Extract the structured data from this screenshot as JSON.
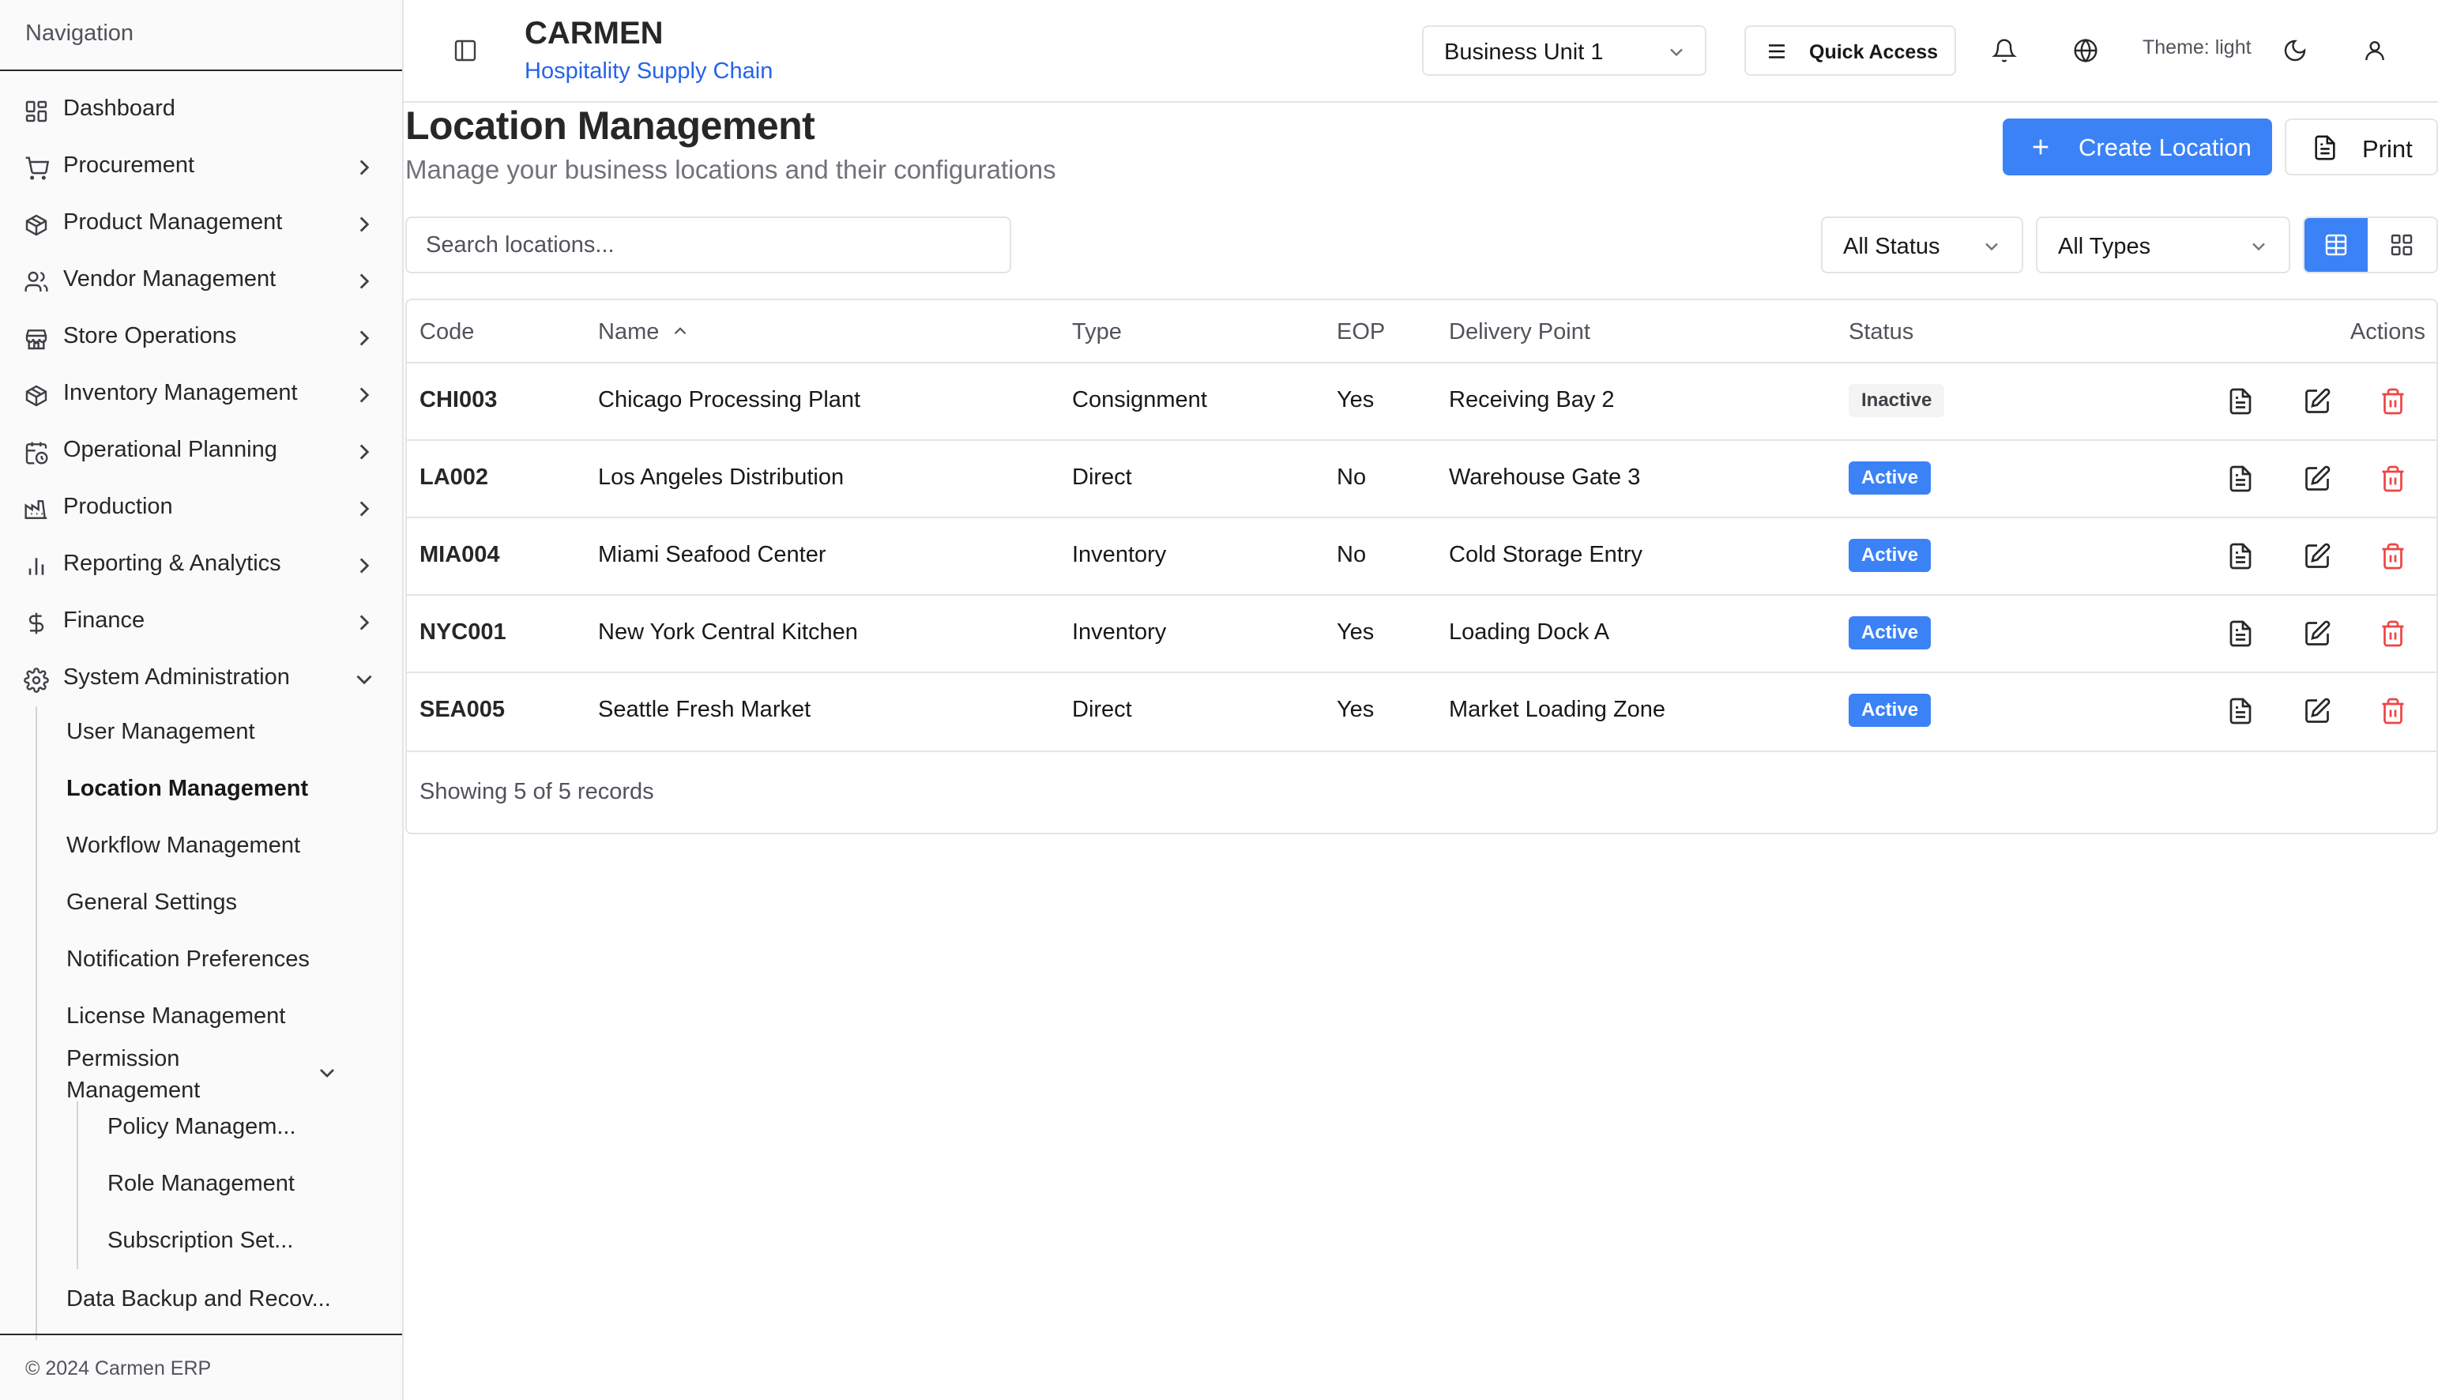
{
  "sidebar": {
    "heading": "Navigation",
    "items": [
      {
        "label": "Dashboard",
        "icon": "dashboard-icon",
        "has_chevron": false
      },
      {
        "label": "Procurement",
        "icon": "cart-icon",
        "has_chevron": true
      },
      {
        "label": "Product Management",
        "icon": "package-icon",
        "has_chevron": true
      },
      {
        "label": "Vendor Management",
        "icon": "users-icon",
        "has_chevron": true
      },
      {
        "label": "Store Operations",
        "icon": "store-icon",
        "has_chevron": true
      },
      {
        "label": "Inventory Management",
        "icon": "package-icon",
        "has_chevron": true
      },
      {
        "label": "Operational Planning",
        "icon": "calendar-clock-icon",
        "has_chevron": true
      },
      {
        "label": "Production",
        "icon": "factory-icon",
        "has_chevron": true
      },
      {
        "label": "Reporting & Analytics",
        "icon": "bar-chart-icon",
        "has_chevron": true
      },
      {
        "label": "Finance",
        "icon": "dollar-icon",
        "has_chevron": true
      },
      {
        "label": "System Administration",
        "icon": "gear-icon",
        "expanded": true
      }
    ],
    "sub_items": [
      {
        "label": "User Management"
      },
      {
        "label": "Location Management",
        "active": true
      },
      {
        "label": "Workflow Management"
      },
      {
        "label": "General Settings"
      },
      {
        "label": "Notification Preferences"
      },
      {
        "label": "License Management"
      },
      {
        "label": "Permission Management",
        "expanded": true
      },
      {
        "label": "Data Backup and Recov..."
      }
    ],
    "permission_items": [
      {
        "label": "Policy Managem..."
      },
      {
        "label": "Role Management"
      },
      {
        "label": "Subscription Set..."
      }
    ],
    "footer": "© 2024 Carmen ERP"
  },
  "topbar": {
    "brand": "CARMEN",
    "brand_sub": "Hospitality Supply Chain",
    "business_unit": "Business Unit 1",
    "quick_access": "Quick Access",
    "theme_label": "Theme: light"
  },
  "page": {
    "title": "Location Management",
    "subtitle": "Manage your business locations and their configurations",
    "create_label": "Create Location",
    "print_label": "Print",
    "search_placeholder": "Search locations...",
    "status_filter": "All Status",
    "type_filter": "All Types"
  },
  "table": {
    "columns": [
      "Code",
      "Name",
      "Type",
      "EOP",
      "Delivery Point",
      "Status",
      "Actions"
    ],
    "sort_column": "Name",
    "sort_direction": "ascending",
    "rows": [
      {
        "code": "CHI003",
        "name": "Chicago Processing Plant",
        "type": "Consignment",
        "eop": "Yes",
        "delivery_point": "Receiving Bay 2",
        "status": "Inactive"
      },
      {
        "code": "LA002",
        "name": "Los Angeles Distribution",
        "type": "Direct",
        "eop": "No",
        "delivery_point": "Warehouse Gate 3",
        "status": "Active"
      },
      {
        "code": "MIA004",
        "name": "Miami Seafood Center",
        "type": "Inventory",
        "eop": "No",
        "delivery_point": "Cold Storage Entry",
        "status": "Active"
      },
      {
        "code": "NYC001",
        "name": "New York Central Kitchen",
        "type": "Inventory",
        "eop": "Yes",
        "delivery_point": "Loading Dock A",
        "status": "Active"
      },
      {
        "code": "SEA005",
        "name": "Seattle Fresh Market",
        "type": "Direct",
        "eop": "Yes",
        "delivery_point": "Market Loading Zone",
        "status": "Active"
      }
    ],
    "footer": "Showing 5 of 5 records"
  },
  "colors": {
    "accent": "#3b82f6",
    "brand_sub": "#2563eb",
    "danger": "#ef4444"
  }
}
